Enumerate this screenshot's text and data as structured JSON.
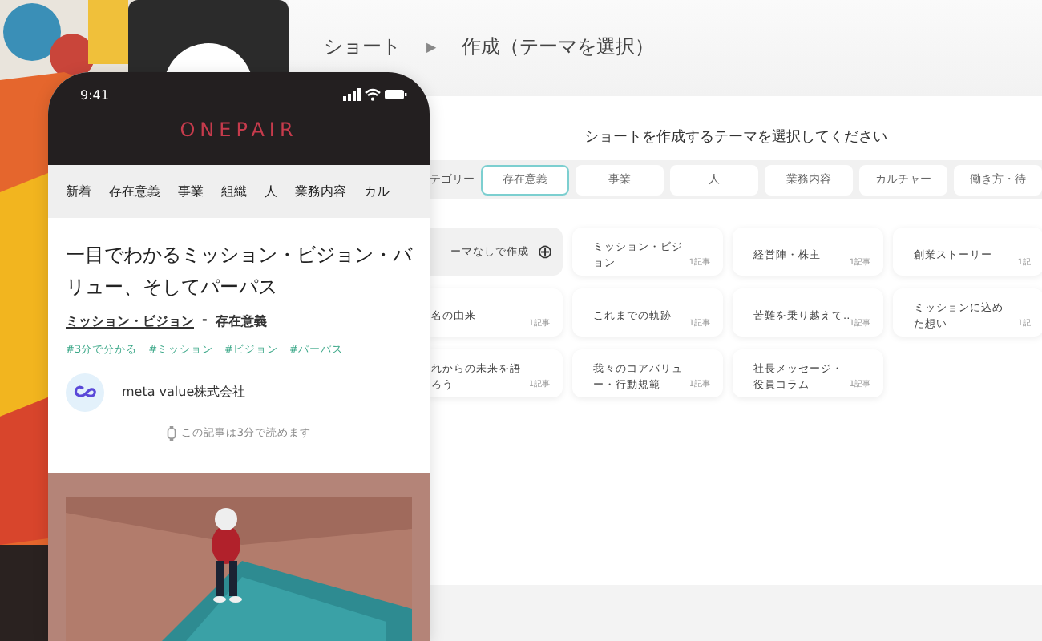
{
  "desktop": {
    "breadcrumb": [
      {
        "label": "ショート"
      },
      {
        "label": "作成（テーマを選択）"
      }
    ],
    "breadcrumb_separator": "▶",
    "heading": "ショートを作成するテーマを選択してください",
    "category_label": "テゴリー",
    "category_tabs": [
      {
        "label": "存在意義",
        "selected": true
      },
      {
        "label": "事業",
        "selected": false
      },
      {
        "label": "人",
        "selected": false
      },
      {
        "label": "業務内容",
        "selected": false
      },
      {
        "label": "カルチャー",
        "selected": false
      },
      {
        "label": "働き方・待",
        "selected": false
      }
    ],
    "themes": [
      {
        "kind": "create",
        "label": "ーマなしで作成",
        "icon": "⊕"
      },
      {
        "kind": "theme",
        "label": "ミッション・ビジョン",
        "count": "1記事"
      },
      {
        "kind": "theme",
        "label": "経営陣・株主",
        "count": "1記事"
      },
      {
        "kind": "theme",
        "label": "創業ストーリー",
        "count": "1記"
      },
      {
        "kind": "theme",
        "label": "名の由来",
        "count": "1記事"
      },
      {
        "kind": "theme",
        "label": "これまでの軌跡",
        "count": "1記事"
      },
      {
        "kind": "theme",
        "label": "苦難を乗り越えて..",
        "count": "1記事"
      },
      {
        "kind": "theme",
        "label": "ミッションに込めた想い",
        "count": "1記"
      },
      {
        "kind": "theme",
        "label": "れからの未来を語ろう",
        "count": "1記事"
      },
      {
        "kind": "theme",
        "label": "我々のコアバリュー・行動規範",
        "count": "1記事"
      },
      {
        "kind": "theme",
        "label": "社長メッセージ・役員コラム",
        "count": "1記事"
      }
    ]
  },
  "phone": {
    "time": "9:41",
    "logo": "ONEPAIR",
    "nav": [
      {
        "label": "新着"
      },
      {
        "label": "存在意義"
      },
      {
        "label": "事業"
      },
      {
        "label": "組織"
      },
      {
        "label": "人"
      },
      {
        "label": "業務内容"
      },
      {
        "label": "カル"
      }
    ],
    "article": {
      "title": "一目でわかるミッション・ビジョン・バリュー、そしてパーパス",
      "theme": "ミッション・ビジョン",
      "separator": "-",
      "category": "存在意義",
      "tags": [
        "#3分で分かる",
        "#ミッション",
        "#ビジョン",
        "#パーパス"
      ],
      "company": "meta value株式会社",
      "reading_time": "この記事は3分で読めます"
    }
  }
}
